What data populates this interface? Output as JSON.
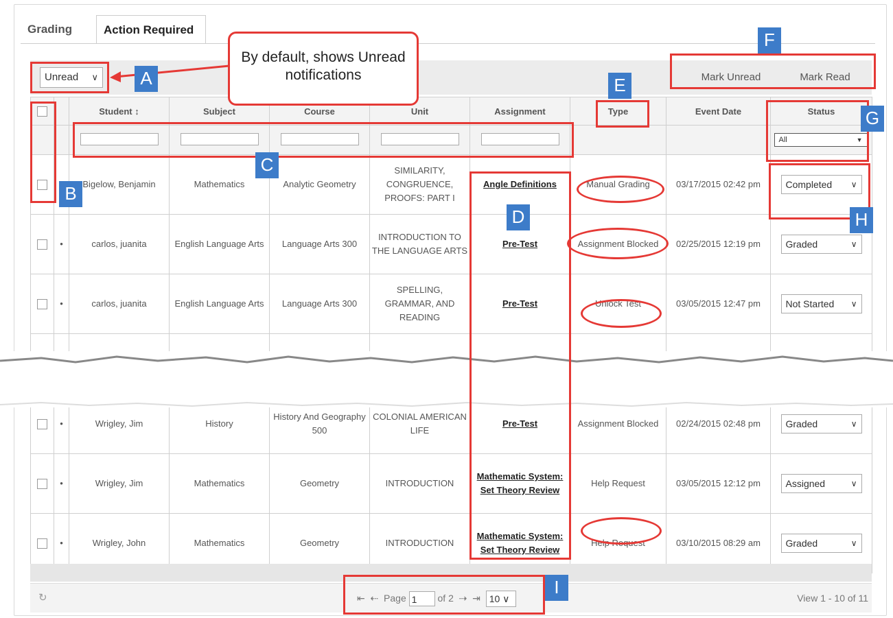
{
  "tabs": {
    "grading": "Grading",
    "action_required": "Action Required"
  },
  "filter": {
    "read_state": "Unread"
  },
  "toolbar": {
    "mark_unread": "Mark Unread",
    "mark_read": "Mark Read"
  },
  "columns": [
    "Student ↕",
    "Subject",
    "Course",
    "Unit",
    "Assignment",
    "Type",
    "Event Date",
    "Status"
  ],
  "status_filter": "All",
  "rows": [
    {
      "student": "Bigelow, Benjamin",
      "subject": "Mathematics",
      "course": "Analytic Geometry",
      "unit": "SIMILARITY, CONGRUENCE, PROOFS: PART I",
      "assignment": "Angle Definitions",
      "type": "Manual Grading",
      "date": "03/17/2015 02:42 pm",
      "status": "Completed",
      "dot": ""
    },
    {
      "student": "carlos, juanita",
      "subject": "English Language Arts",
      "course": "Language Arts 300",
      "unit": "INTRODUCTION TO THE LANGUAGE ARTS",
      "assignment": "Pre-Test",
      "type": "Assignment Blocked",
      "date": "02/25/2015 12:19 pm",
      "status": "Graded",
      "dot": "•"
    },
    {
      "student": "carlos, juanita",
      "subject": "English Language Arts",
      "course": "Language Arts 300",
      "unit": "SPELLING, GRAMMAR, AND READING",
      "assignment": "Pre-Test",
      "type": "Unlock Test",
      "date": "03/05/2015 12:47 pm",
      "status": "Not Started",
      "dot": "•"
    },
    {
      "student": "Wrigley, Jim",
      "subject": "History",
      "course": "History And Geography 500",
      "unit": "COLONIAL AMERICAN LIFE",
      "assignment": "Pre-Test",
      "type": "Assignment Blocked",
      "date": "02/24/2015 02:48 pm",
      "status": "Graded",
      "dot": "•"
    },
    {
      "student": "Wrigley, Jim",
      "subject": "Mathematics",
      "course": "Geometry",
      "unit": "INTRODUCTION",
      "assignment": "Mathematic System: Set Theory Review",
      "type": "Help Request",
      "date": "03/05/2015 12:12 pm",
      "status": "Assigned",
      "dot": "•"
    },
    {
      "student": "Wrigley, John",
      "subject": "Mathematics",
      "course": "Geometry",
      "unit": "INTRODUCTION",
      "assignment": "Mathematic System: Set Theory Review",
      "type": "Help Request",
      "date": "03/10/2015 08:29 am",
      "status": "Graded",
      "dot": "•"
    }
  ],
  "pager": {
    "page_label": "Page",
    "page": "1",
    "of_label": "of 2",
    "rows_per_page": "10",
    "view_count": "View 1 - 10 of 11"
  },
  "annotations": {
    "callout": "By default, shows Unread notifications",
    "labels": [
      "A",
      "B",
      "C",
      "D",
      "E",
      "F",
      "G",
      "H",
      "I"
    ]
  },
  "colors": {
    "annotation_red": "#e53935",
    "label_blue": "#3d7cc9"
  }
}
